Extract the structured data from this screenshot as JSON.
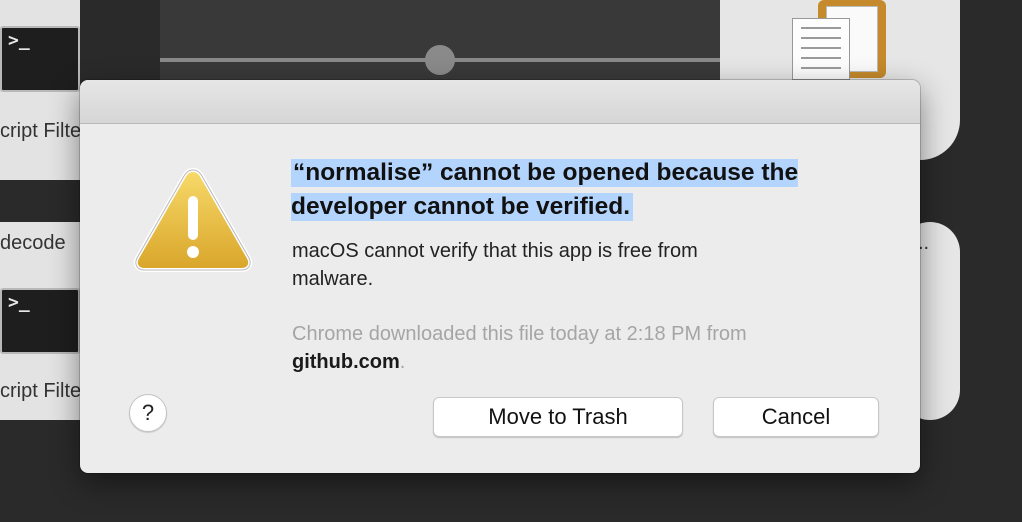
{
  "background": {
    "left_items": [
      {
        "label": "cript Filte"
      },
      {
        "label": "decode"
      },
      {
        "label": "cript Filte"
      }
    ],
    "right_fragments": [
      "d",
      ".."
    ],
    "terminal_prompt": ">_"
  },
  "dialog": {
    "title": "“normalise” cannot be opened because the developer cannot be verified.",
    "body": "macOS cannot verify that this app is free from malware.",
    "source_prefix": "Chrome downloaded this file today at 2:18 PM from",
    "source_domain": "github.com",
    "source_suffix": ".",
    "help_label": "?",
    "buttons": {
      "trash": "Move to Trash",
      "cancel": "Cancel"
    },
    "icon": "warning-icon",
    "highlight_color": "#b3d4fd"
  }
}
